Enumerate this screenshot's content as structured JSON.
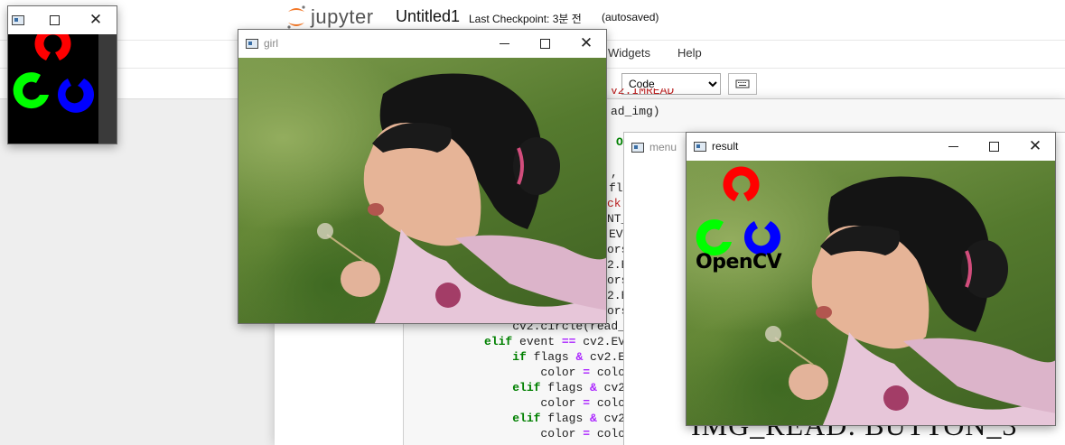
{
  "jupyter": {
    "brand": "jupyter",
    "notebook_title": "Untitled1",
    "checkpoint": "Last Checkpoint: 3분 전",
    "autosave": "(autosaved)",
    "menu": [
      "Widgets",
      "Help"
    ],
    "cell_type": "Code",
    "cell_type_options": [
      "Code"
    ]
  },
  "code_lines": [
    {
      "segments": [
        {
          "t": "ad_img)",
          "c": ""
        }
      ]
    },
    {
      "segments": [
        {
          "t": "O",
          "c": "kw"
        }
      ]
    },
    {
      "segments": [
        {
          "t": ", f",
          "c": ""
        }
      ]
    },
    {
      "segments": [
        {
          "t": "fla",
          "c": ""
        }
      ]
    },
    {
      "segments": [
        {
          "t": "ck'",
          "c": "str"
        }
      ]
    },
    {
      "segments": [
        {
          "t": "NT_",
          "c": ""
        }
      ]
    },
    {
      "segments": [
        {
          "t": "EVE",
          "c": ""
        }
      ]
    },
    {
      "segments": [
        {
          "t": "ors",
          "c": ""
        }
      ]
    },
    {
      "segments": [
        {
          "t": "2.E",
          "c": ""
        }
      ]
    },
    {
      "segments": [
        {
          "t": "ors",
          "c": ""
        }
      ]
    },
    {
      "segments": [
        {
          "t": "2.E",
          "c": ""
        }
      ]
    },
    {
      "segments": [
        {
          "t": "ors",
          "c": ""
        }
      ]
    },
    {
      "segments": [
        {
          "t": "    cv2.circle(read_im",
          "c": ""
        }
      ]
    },
    {
      "segments": [
        {
          "t": "elif",
          "c": "kw"
        },
        {
          "t": " event ",
          "c": ""
        },
        {
          "t": "==",
          "c": "op"
        },
        {
          "t": " cv2.EVE",
          "c": ""
        }
      ]
    },
    {
      "segments": [
        {
          "t": "    ",
          "c": ""
        },
        {
          "t": "if",
          "c": "kw"
        },
        {
          "t": " flags ",
          "c": ""
        },
        {
          "t": "&",
          "c": "op"
        },
        {
          "t": " cv2.EVE",
          "c": ""
        }
      ]
    },
    {
      "segments": [
        {
          "t": "        color ",
          "c": ""
        },
        {
          "t": "=",
          "c": "op"
        },
        {
          "t": " colors",
          "c": ""
        }
      ]
    },
    {
      "segments": [
        {
          "t": "    ",
          "c": ""
        },
        {
          "t": "elif",
          "c": "kw"
        },
        {
          "t": " flags ",
          "c": ""
        },
        {
          "t": "&",
          "c": "op"
        },
        {
          "t": " cv2.E",
          "c": ""
        }
      ]
    },
    {
      "segments": [
        {
          "t": "        color ",
          "c": ""
        },
        {
          "t": "=",
          "c": "op"
        },
        {
          "t": " colors",
          "c": ""
        }
      ]
    },
    {
      "segments": [
        {
          "t": "    ",
          "c": ""
        },
        {
          "t": "elif",
          "c": "kw"
        },
        {
          "t": " flags ",
          "c": ""
        },
        {
          "t": "&",
          "c": "op"
        },
        {
          "t": " cv2.E",
          "c": ""
        }
      ]
    },
    {
      "segments": [
        {
          "t": "        color ",
          "c": ""
        },
        {
          "t": "=",
          "c": "op"
        },
        {
          "t": " colors",
          "c": ""
        }
      ]
    }
  ],
  "windows": {
    "logo_window": {
      "title": ""
    },
    "girl_window": {
      "title": "girl"
    },
    "menu_window": {
      "title": "menu",
      "status_text": "IMG_READ: BUTTON_3"
    },
    "result_window": {
      "title": "result",
      "logo_text": "OpenCV"
    }
  },
  "colors": {
    "opencv_red": "#ff0000",
    "opencv_green": "#00ff00",
    "opencv_blue": "#0000ff"
  }
}
